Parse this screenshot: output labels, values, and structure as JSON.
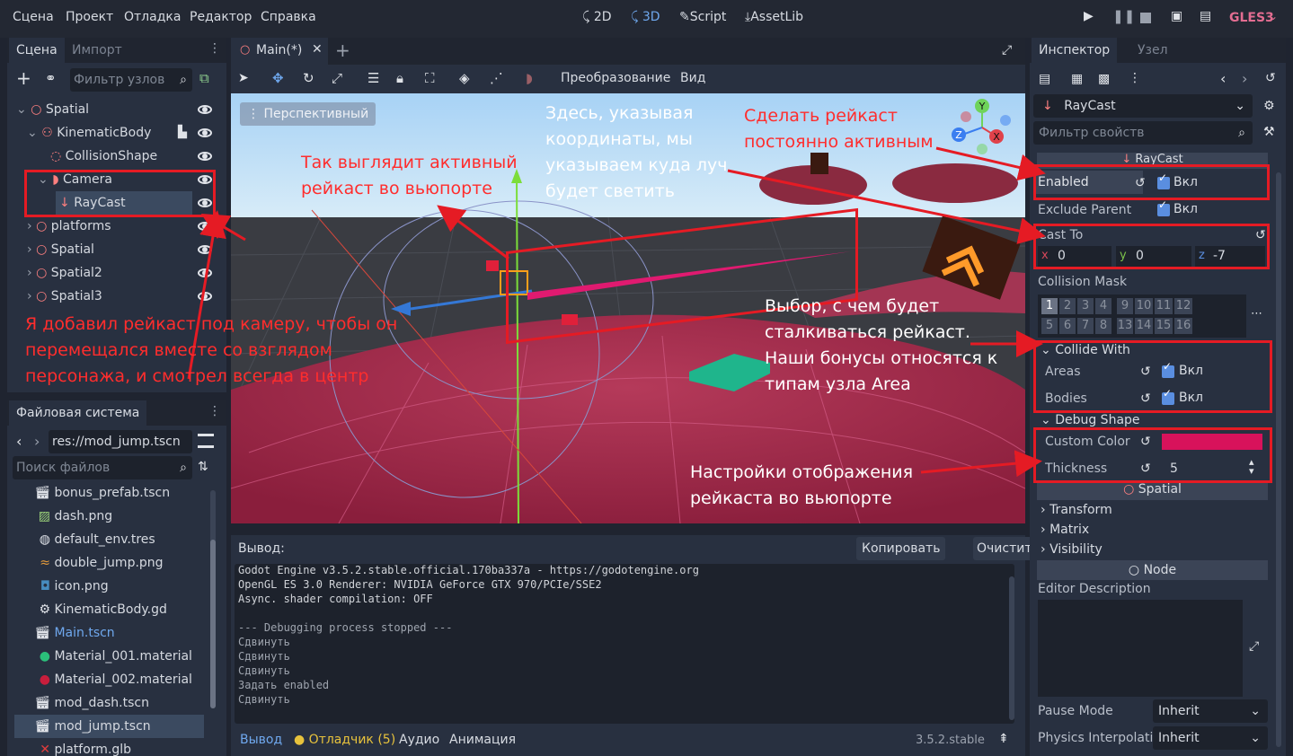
{
  "menu": {
    "items": [
      "Сцена",
      "Проект",
      "Отладка",
      "Редактор",
      "Справка"
    ]
  },
  "workspaces": {
    "w2d": "2D",
    "w3d": "3D",
    "script": "Script",
    "assetlib": "AssetLib"
  },
  "renderer": "GLES3",
  "scene_dock": {
    "tabs": [
      "Сцена",
      "Импорт"
    ],
    "filter_placeholder": "Фильтр узлов",
    "nodes": [
      {
        "label": "Spatial",
        "depth": 0,
        "expanded": true
      },
      {
        "label": "KinematicBody",
        "depth": 1,
        "expanded": true
      },
      {
        "label": "CollisionShape",
        "depth": 2
      },
      {
        "label": "Camera",
        "depth": 2,
        "expanded": true
      },
      {
        "label": "RayCast",
        "depth": 3,
        "selected": true
      },
      {
        "label": "platforms",
        "depth": 1
      },
      {
        "label": "Spatial",
        "depth": 1
      },
      {
        "label": "Spatial2",
        "depth": 1
      },
      {
        "label": "Spatial3",
        "depth": 1
      }
    ]
  },
  "filesystem": {
    "title": "Файловая система",
    "path": "res://mod_jump.tscn",
    "search_placeholder": "Поиск файлов",
    "files": [
      "bonus_prefab.tscn",
      "dash.png",
      "default_env.tres",
      "double_jump.png",
      "icon.png",
      "KinematicBody.gd",
      "Main.tscn",
      "Material_001.material",
      "Material_002.material",
      "mod_dash.tscn",
      "mod_jump.tscn",
      "platform.glb"
    ]
  },
  "editor": {
    "tab": "Main(*)",
    "toolbar": {
      "transform": "Преобразование",
      "view": "Вид"
    },
    "viewport_label": "Перспективный",
    "gizmo": {
      "y": "Y",
      "z": "Z",
      "x": "X"
    }
  },
  "output": {
    "title": "Вывод:",
    "copy": "Копировать",
    "clear": "Очистить",
    "lines": [
      "Godot Engine v3.5.2.stable.official.170ba337a - https://godotengine.org",
      "OpenGL ES 3.0 Renderer: NVIDIA GeForce GTX 970/PCIe/SSE2",
      "Async. shader compilation: OFF",
      "",
      "--- Debugging process stopped ---",
      "Сдвинуть",
      "Сдвинуть",
      "Сдвинуть",
      "Задать enabled",
      "Сдвинуть"
    ],
    "bottom_tabs": [
      "Вывод",
      "Отладчик (5)",
      "Аудио",
      "Анимация"
    ],
    "version": "3.5.2.stable"
  },
  "inspector": {
    "tabs": [
      "Инспектор",
      "Узел"
    ],
    "node": "RayCast",
    "filter_placeholder": "Фильтр свойств",
    "section": "RayCast",
    "enabled_label": "Enabled",
    "enabled_value": "Вкл",
    "exclude_parent": "Exclude Parent",
    "exclude_value": "Вкл",
    "cast_to": "Cast To",
    "cast_to_x": "0",
    "cast_to_y": "0",
    "cast_to_z": "-7",
    "axis_x": "x",
    "axis_y": "y",
    "axis_z": "z",
    "collision_mask": "Collision Mask",
    "mask_row1": [
      "1",
      "2",
      "3",
      "4",
      "9",
      "10",
      "11",
      "12"
    ],
    "mask_row2": [
      "5",
      "6",
      "7",
      "8",
      "13",
      "14",
      "15",
      "16"
    ],
    "collide_with": "Collide With",
    "areas": "Areas",
    "areas_value": "Вкл",
    "bodies": "Bodies",
    "bodies_value": "Вкл",
    "debug_shape": "Debug Shape",
    "custom_color": "Custom Color",
    "custom_color_value": "#d8125b",
    "thickness": "Thickness",
    "thickness_value": "5",
    "spatial": "Spatial",
    "transform": "Transform",
    "matrix": "Matrix",
    "visibility": "Visibility",
    "node_section": "Node",
    "editor_description": "Editor Description",
    "pause_mode": "Pause Mode",
    "pause_mode_value": "Inherit",
    "physics_interp": "Physics Interpolati",
    "physics_interp_value": "Inherit"
  },
  "annotations": {
    "active_raycast": "Так выглядит активный рейкаст во вьюпорте",
    "coords": "Здесь, указывая координаты, мы указываем куда луч будет светить",
    "always_active": "Сделать рейкаст постоянно активным",
    "collide": "Выбор, с чем будет сталкиваться рейкаст. Наши бонусы относятся к типам узла Area",
    "display": "Настройки отображения рейкаста во вьюпорте",
    "camera_child": "Я добавил рейкаст под камеру, чтобы он перемещался вместе со взглядом персонажа, и смотрел всегда в центр"
  }
}
